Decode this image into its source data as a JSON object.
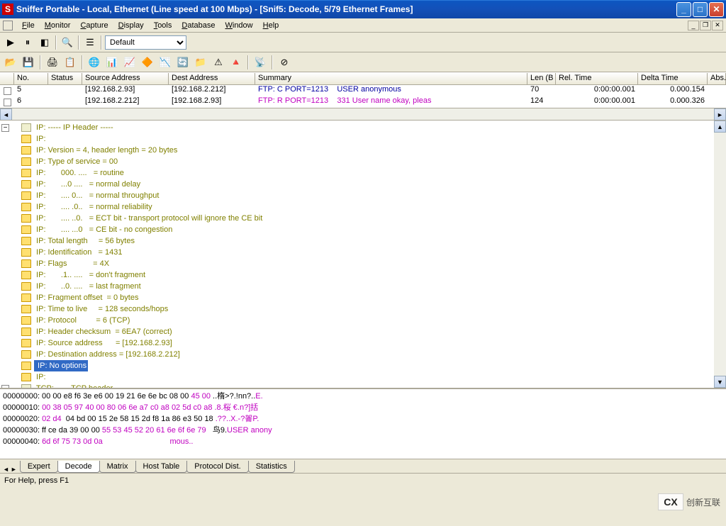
{
  "title": "Sniffer Portable - Local, Ethernet (Line speed at 100 Mbps) - [Snif5: Decode, 5/79 Ethernet Frames]",
  "app_icon_letter": "S",
  "menus": [
    "File",
    "Monitor",
    "Capture",
    "Display",
    "Tools",
    "Database",
    "Window",
    "Help"
  ],
  "menu_underlines": [
    "F",
    "M",
    "C",
    "D",
    "T",
    "D",
    "W",
    "H"
  ],
  "toolbar1_select": "Default",
  "grid_headers": [
    "No.",
    "Status",
    "Source Address",
    "Dest Address",
    "Summary",
    "Len (B",
    "Rel. Time",
    "Delta Time",
    "Abs. Time"
  ],
  "grid_col_widths": [
    48,
    48,
    122,
    122,
    384,
    40,
    116,
    98,
    66
  ],
  "grid_rows": [
    {
      "no": "5",
      "status": "",
      "src": "[192.168.2.93]",
      "dst": "[192.168.2.212]",
      "summary_proto": "FTP: C PORT=1213",
      "summary_rest": "USER anonymous",
      "len": "70",
      "rel": "0:00:00.001",
      "delta": "0.000.154",
      "abs": "",
      "color": "#0000a0"
    },
    {
      "no": "6",
      "status": "",
      "src": "[192.168.2.212]",
      "dst": "[192.168.2.93]",
      "summary_proto": "FTP: R PORT=1213",
      "summary_rest": "331 User name okay, pleas",
      "len": "124",
      "rel": "0:00:00.001",
      "delta": "0.000.326",
      "abs": "",
      "color": "#c000c0"
    }
  ],
  "decode_header": "IP: ----- IP Header -----",
  "decode_lines": [
    "IP:",
    "IP: Version = 4, header length = 20 bytes",
    "IP: Type of service = 00",
    "IP:       000. ....   = routine",
    "IP:       ...0 ....   = normal delay",
    "IP:       .... 0...   = normal throughput",
    "IP:       .... .0..   = normal reliability",
    "IP:       .... ..0.   = ECT bit - transport protocol will ignore the CE bit",
    "IP:       .... ...0   = CE bit - no congestion",
    "IP: Total length     = 56 bytes",
    "IP: Identification   = 1431",
    "IP: Flags            = 4X",
    "IP:       .1.. ....   = don't fragment",
    "IP:       ..0. ....   = last fragment",
    "IP: Fragment offset  = 0 bytes",
    "IP: Time to live     = 128 seconds/hops",
    "IP: Protocol         = 6 (TCP)",
    "IP: Header checksum  = 6EA7 (correct)",
    "IP: Source address      = [192.168.2.93]",
    "IP: Destination address = [192.168.2.212]"
  ],
  "decode_selected": "IP: No options",
  "decode_after_sel": "IP:",
  "decode_tcp": "TCP: ----- TCP header -----",
  "hex_lines": [
    {
      "off": "00000000:",
      "bytes": " 00 00 e8 f6 3e e6 00 19 21 6e 6e bc 08 00 ",
      "sel": "45 00",
      "ascii": " ..楕>?.!nn?..",
      "ascii_sel": "E."
    },
    {
      "off": "00000010:",
      "bytes": " ",
      "sel": "00 38 05 97 40 00 80 06 6e a7 c0 a8 02 5d c0 a8",
      "ascii": " ",
      "ascii_sel": ".8.桜 €.n?]括"
    },
    {
      "off": "00000020:",
      "bytes": " ",
      "sel": "02 d4 ",
      "bytes2": "04 bd 00 15 2e 58 15 2d f8 1a 86 e3 50 18",
      "ascii": " ",
      "ascii_sel": ".??..X.-?嗧P."
    },
    {
      "off": "00000030:",
      "bytes": " ff ce da 39 00 00 ",
      "sel2": "55 53 45 52 20 61 6e 6f 6e 79",
      "ascii": "   鸟9.",
      "ascii_sel2": "USER anony"
    },
    {
      "off": "00000040:",
      "bytes": " ",
      "sel2": "6d 6f 75 73 0d 0a",
      "ascii": "                               ",
      "ascii_sel2": "mous.."
    }
  ],
  "tabs": [
    "Expert",
    "Decode",
    "Matrix",
    "Host Table",
    "Protocol Dist.",
    "Statistics"
  ],
  "active_tab": 1,
  "statusbar_text": "For Help, press F1",
  "watermark_text": "创新互联"
}
